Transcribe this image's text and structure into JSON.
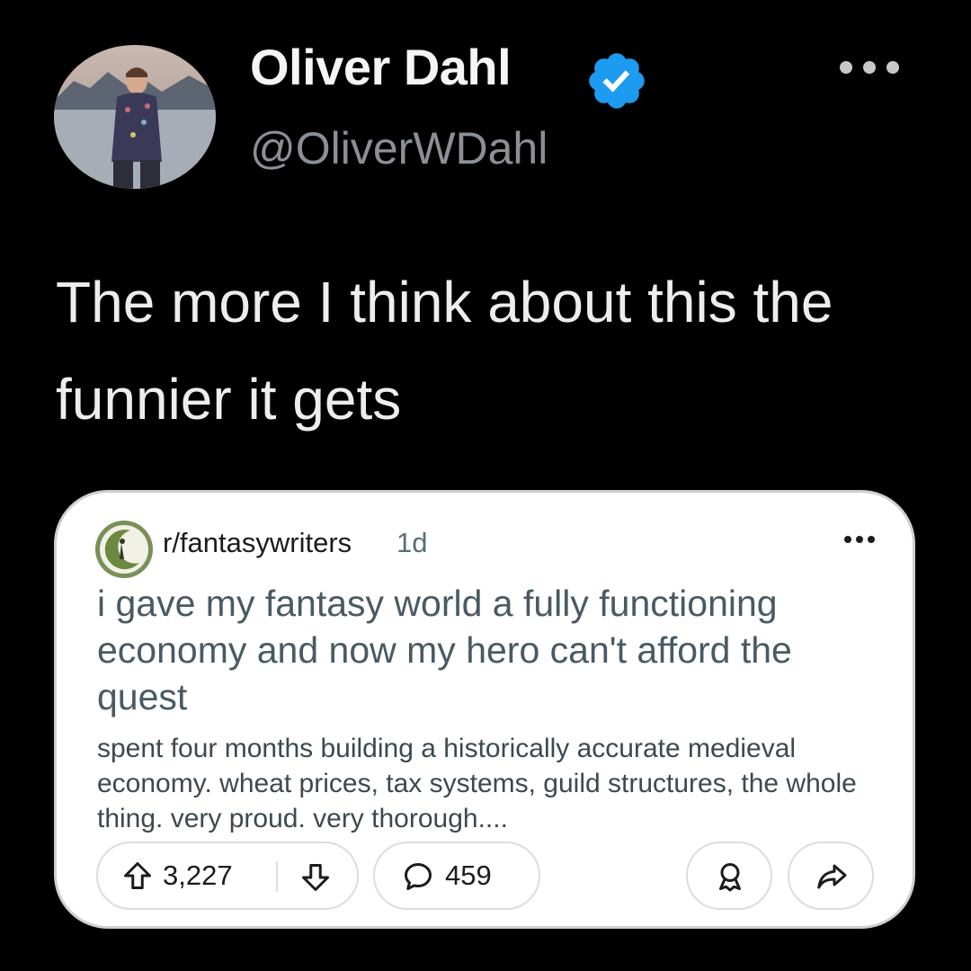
{
  "tweet": {
    "author": {
      "name": "Oliver Dahl",
      "handle": "@OliverWDahl",
      "verified": true
    },
    "text": "The more I think about this the funnier it gets"
  },
  "embedded_post": {
    "subreddit": "r/fantasywriters",
    "age": "1d",
    "title": "i gave my fantasy world a fully functioning economy and now my hero can't afford the quest",
    "body": "spent four months building a historically accurate medieval economy. wheat prices, tax systems, guild structures, the whole thing. very proud. very thorough....",
    "upvotes": "3,227",
    "comments": "459"
  },
  "icons": {
    "verified": "verified-badge-icon",
    "more": "more-dots-icon",
    "upvote": "arrow-up-icon",
    "downvote": "arrow-down-icon",
    "comment": "speech-bubble-icon",
    "award": "award-icon",
    "share": "share-arrow-icon"
  },
  "colors": {
    "background": "#000000",
    "verified": "#1d9bf0",
    "handle": "#8b9096",
    "card": "#ffffff"
  }
}
